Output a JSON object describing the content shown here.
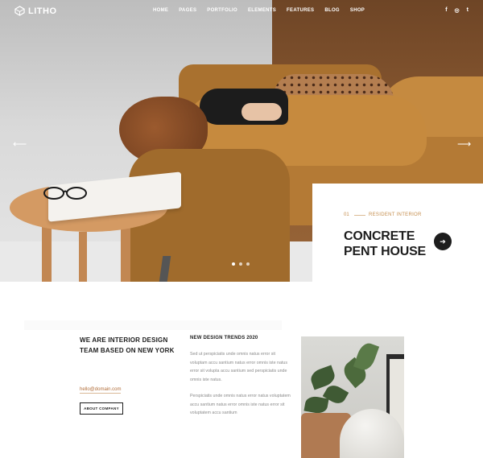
{
  "nav": {
    "logo": "LITHO",
    "menu": [
      "HOME",
      "PAGES",
      "PORTFOLIO",
      "ELEMENTS",
      "FEATURES",
      "BLOG",
      "SHOP"
    ],
    "social": [
      "f",
      "◎",
      "t"
    ]
  },
  "hero": {
    "prev_arrow": "⟵",
    "next_arrow": "⟶",
    "slide_count": 3,
    "active_slide": 1
  },
  "card": {
    "index": "01",
    "category": "RESIDENT INTERIOR",
    "title": "CONCRETE PENT HOUSE",
    "button_icon": "➔"
  },
  "intro": {
    "lead": "WE ARE INTERIOR DESIGN TEAM BASED ON NEW YORK",
    "email": "hello@domain.com",
    "button": "ABOUT COMPANY"
  },
  "trends": {
    "title": "NEW DESIGN TRENDS 2020",
    "paragraph1": "Sed ut perspiciatis unde omnis natus error sit voluptam accu santium natus error omnis iste natus error sit volupta accu santium sed perspiciatis unde omnis iste natus.",
    "paragraph2": "Perspiciatis unde omnis natus error natus voluptatem accu santium natus error omnis iste natus error sit voluptatem accu santium"
  },
  "colors": {
    "accent": "#c58e4e",
    "dark": "#1d1d1d",
    "text_muted": "#8a8a8a"
  }
}
